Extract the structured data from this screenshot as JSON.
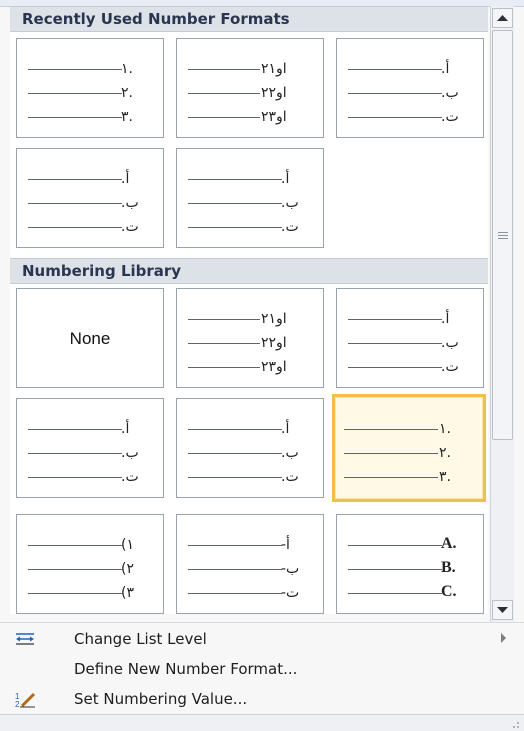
{
  "sections": {
    "recent_header": "Recently Used Number Formats",
    "library_header": "Numbering Library"
  },
  "recent": [
    [
      "١.",
      "٢.",
      "٣."
    ],
    [
      "او٢١",
      "او٢٢",
      "او٢٣"
    ],
    [
      "أ.",
      "ب.",
      "ت."
    ],
    [
      "أ.",
      "ب.",
      "ت."
    ],
    [
      "أ.",
      "ب.",
      "ت."
    ]
  ],
  "library": {
    "none_label": "None",
    "tiles": [
      [
        "او٢١",
        "او٢٢",
        "او٢٣"
      ],
      [
        "أ.",
        "ب.",
        "ت."
      ],
      [
        "أ.",
        "ب.",
        "ت."
      ],
      [
        "أ.",
        "ب.",
        "ت."
      ],
      [
        "١.",
        "٢.",
        "٣."
      ],
      [
        "(١",
        "(٢",
        "(٣"
      ],
      [
        "أ-",
        "ب-",
        "ت-"
      ],
      [
        "A.",
        "B.",
        "C."
      ]
    ]
  },
  "menu": {
    "change_list_level": "Change List Level",
    "define_new_number_format": "Define New Number Format...",
    "set_numbering_value": "Set Numbering Value..."
  },
  "icons": {
    "change_list_level": "indent-arrows-icon",
    "set_numbering_value": "numbering-pencil-icon"
  },
  "colors": {
    "selected_border": "#f2c04a",
    "header_bg": "#dde1e8"
  }
}
